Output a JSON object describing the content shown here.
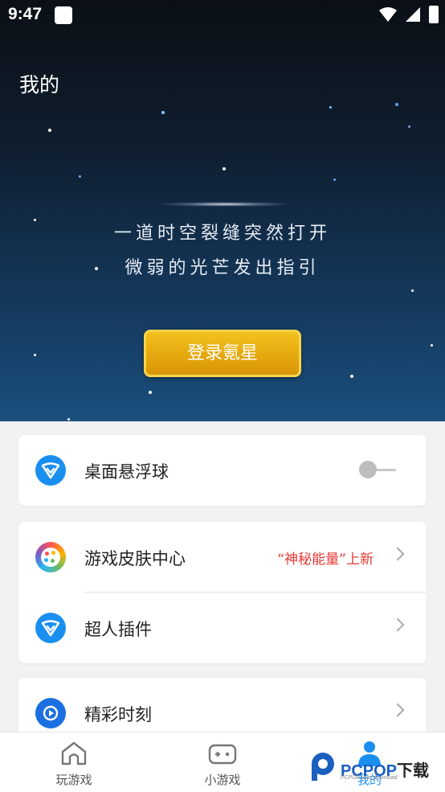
{
  "status_bar": {
    "time": "9:47"
  },
  "header": {
    "title": "我的"
  },
  "hero": {
    "tagline_line1": "一道时空裂缝突然打开",
    "tagline_line2": "微弱的光芒发出指引",
    "login_button": "登录氪星"
  },
  "settings": {
    "floating_ball": {
      "label": "桌面悬浮球",
      "enabled": false
    }
  },
  "menu": {
    "skin_center": {
      "label": "游戏皮肤中心",
      "badge": "“神秘能量”上新"
    },
    "superman_plugin": {
      "label": "超人插件"
    },
    "highlights": {
      "label": "精彩时刻"
    }
  },
  "tabbar": {
    "tabs": [
      {
        "label": "玩游戏",
        "icon": "home-icon"
      },
      {
        "label": "小游戏",
        "icon": "gamepad-icon"
      },
      {
        "label": "我的",
        "icon": "person-icon",
        "active": true
      }
    ]
  },
  "watermark": {
    "text_latin": "PCPOP",
    "text_cn": "下载",
    "sub": "PCPOP.com download"
  },
  "colors": {
    "accent": "#1b8ff0",
    "gold_button": "#e5a80e",
    "promo_red": "#e53935"
  }
}
